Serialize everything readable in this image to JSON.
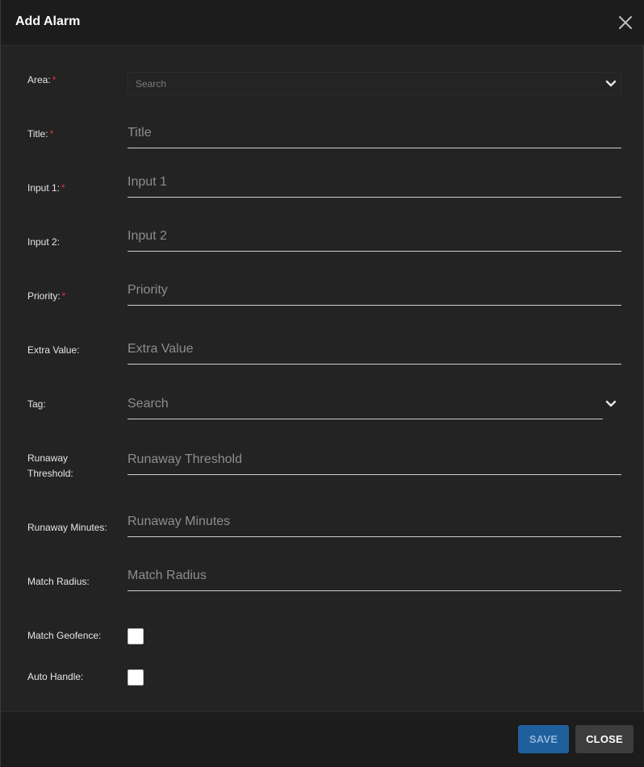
{
  "dialog": {
    "title": "Add Alarm"
  },
  "fields": {
    "area": {
      "label": "Area:",
      "required": "*",
      "placeholder": "Search"
    },
    "title": {
      "label": "Title:",
      "required": "*",
      "placeholder": "Title"
    },
    "input1": {
      "label": "Input 1:",
      "required": "*",
      "placeholder": "Input 1"
    },
    "input2": {
      "label": "Input 2:",
      "placeholder": "Input 2"
    },
    "priority": {
      "label": "Priority:",
      "required": "*",
      "placeholder": "Priority"
    },
    "extra_value": {
      "label": "Extra Value:",
      "placeholder": "Extra Value"
    },
    "tag": {
      "label": "Tag:",
      "placeholder": "Search"
    },
    "runaway_threshold": {
      "label_line1": "Runaway",
      "label_line2": "Threshold:",
      "placeholder": "Runaway Threshold"
    },
    "runaway_minutes": {
      "label": "Runaway Minutes:",
      "placeholder": "Runaway Minutes"
    },
    "match_radius": {
      "label": "Match Radius:",
      "placeholder": "Match Radius"
    },
    "match_geofence": {
      "label": "Match Geofence:"
    },
    "auto_handle": {
      "label": "Auto Handle:"
    }
  },
  "footer": {
    "save_label": "SAVE",
    "close_label": "CLOSE"
  },
  "colors": {
    "background": "#232323",
    "required_asterisk": "#e0343d",
    "save_button": "#1f5f9c",
    "close_button": "#3d3d3d"
  },
  "icons": {
    "close": "close-icon",
    "dropdown": "chevron-down-icon"
  }
}
